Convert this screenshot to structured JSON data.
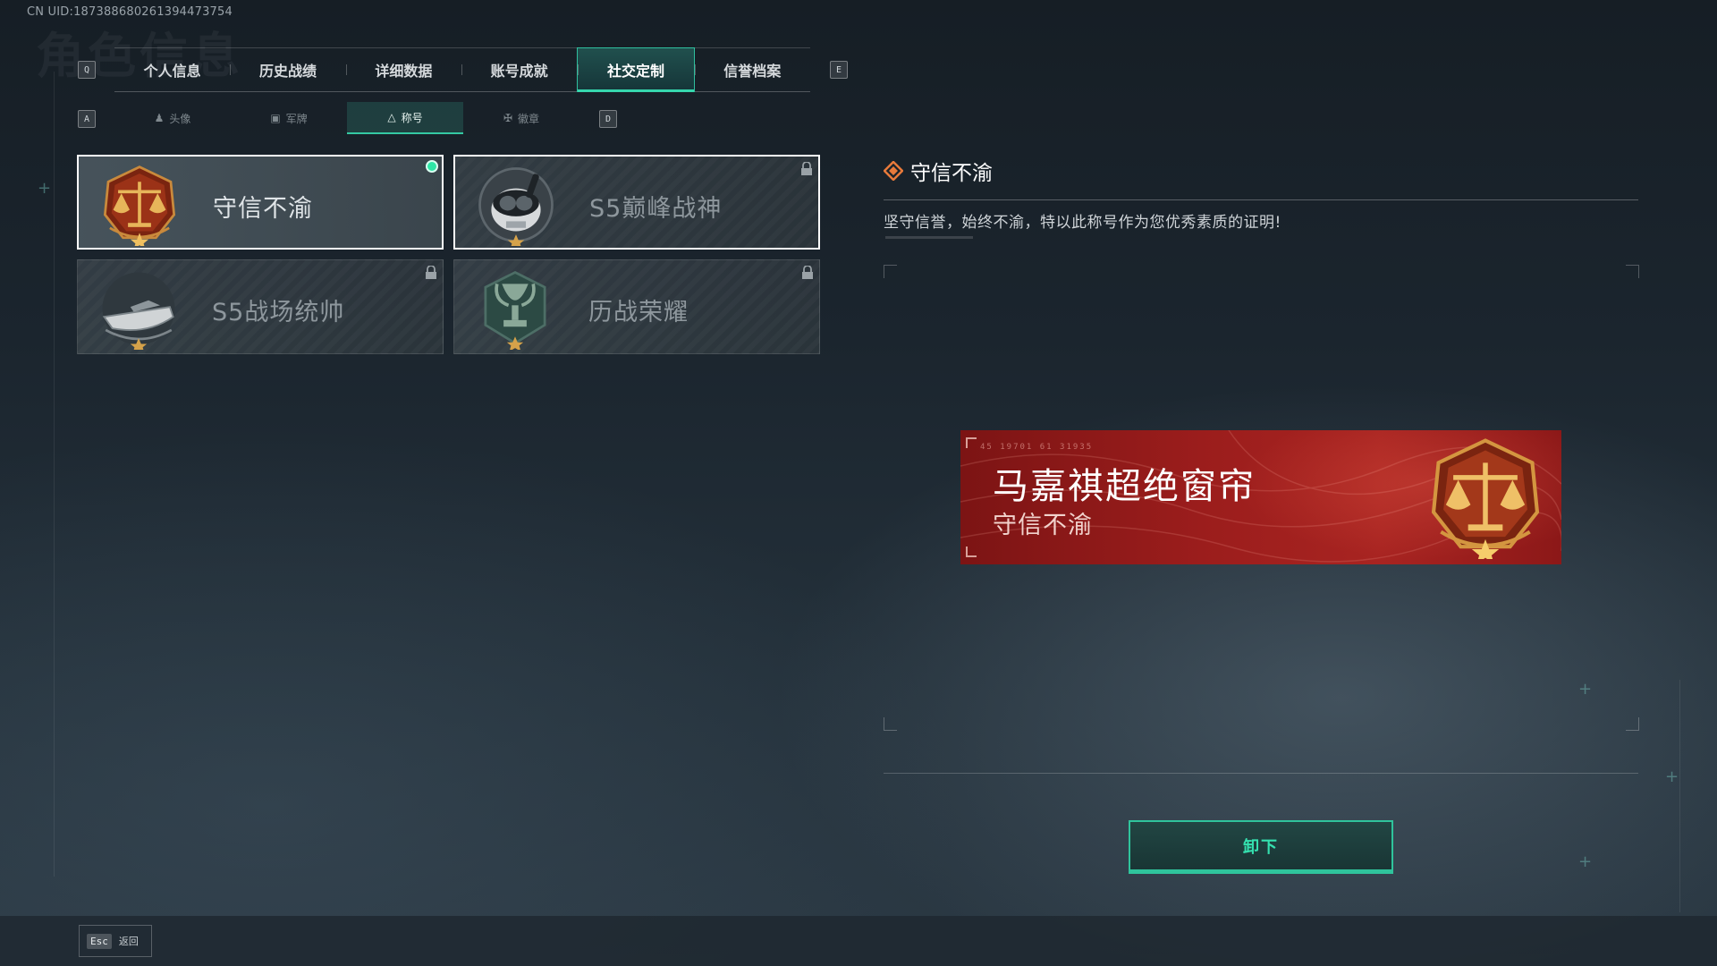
{
  "uid": "CN UID:187388680261394473754",
  "bg_title": "角色信息",
  "nav": {
    "prev_key": "Q",
    "next_key": "E",
    "tabs": [
      {
        "label": "个人信息"
      },
      {
        "label": "历史战绩"
      },
      {
        "label": "详细数据"
      },
      {
        "label": "账号成就"
      },
      {
        "label": "社交定制",
        "active": true
      },
      {
        "label": "信誉档案"
      }
    ]
  },
  "subnav": {
    "prev_key": "A",
    "next_key": "D",
    "tabs": [
      {
        "label": "头像",
        "icon": "person-icon"
      },
      {
        "label": "军牌",
        "icon": "dogtag-icon"
      },
      {
        "label": "称号",
        "icon": "title-icon",
        "active": true
      },
      {
        "label": "徽章",
        "icon": "badge-icon"
      }
    ]
  },
  "titles": [
    {
      "name": "守信不渝",
      "emblem": "scales-emblem",
      "equipped": true,
      "locked": false
    },
    {
      "name": "S5巅峰战神",
      "emblem": "diver-skull-emblem",
      "equipped": false,
      "locked": true
    },
    {
      "name": "S5战场统帅",
      "emblem": "speedboat-emblem",
      "equipped": false,
      "locked": true
    },
    {
      "name": "历战荣耀",
      "emblem": "trophy-emblem",
      "equipped": false,
      "locked": true
    }
  ],
  "detail": {
    "title": "守信不渝",
    "description": "坚守信誉，始终不渝，特以此称号作为您优秀素质的证明!"
  },
  "nameplate": {
    "player_name": "马嘉祺超绝窗帘",
    "title": "守信不渝",
    "emblem": "scales-emblem",
    "small_text": "45 19701   61 31935"
  },
  "actions": {
    "unequip_label": "卸下",
    "back_key": "Esc",
    "back_label": "返回"
  },
  "colors": {
    "accent": "#2fc49c",
    "equipped_dot": "#2ee6a6",
    "plate_red": "#9b1d1c"
  }
}
